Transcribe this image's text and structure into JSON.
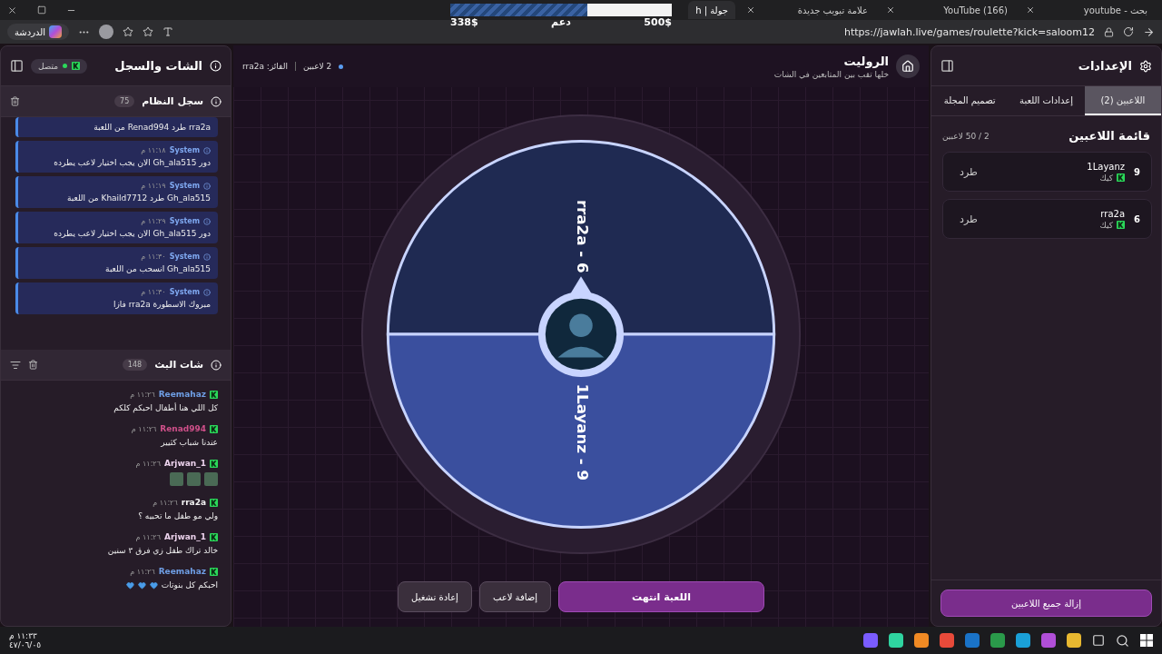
{
  "browser": {
    "tabs": [
      {
        "title": "بحث - youtube",
        "selected": false
      },
      {
        "title": "(166) YouTube",
        "selected": false
      },
      {
        "title": "علامة تبويب جديدة",
        "selected": false
      },
      {
        "title": "جولة | h",
        "selected": true
      }
    ],
    "url": "https://jawlah.live/games/roulette?kick=saloom12",
    "chat_button": "الدردشة"
  },
  "donation_overlay": {
    "level": 0.62,
    "raised": "338$",
    "label": "دعم",
    "goal": "500$"
  },
  "settings": {
    "title": "الإعدادات",
    "tabs": [
      {
        "label": "اللاعبين (2)",
        "selected": true
      },
      {
        "label": "إعدادات اللعبة",
        "selected": false
      },
      {
        "label": "تصميم المجلة",
        "selected": false
      }
    ],
    "list_title": "قائمة اللاعبين",
    "count": "2 / 50 لاعبين",
    "players": [
      {
        "number": "9",
        "name": "1Layanz",
        "platform": "كيك",
        "action": "طرد"
      },
      {
        "number": "6",
        "name": "rra2a",
        "platform": "كيك",
        "action": "طرد"
      }
    ],
    "remove_all": "إزالة جميع اللاعبين"
  },
  "game": {
    "title": "الروليت",
    "subtitle": "خلها تقب بين المتابعين في الشات",
    "players": "2 لاعبين",
    "winner": "الفائز: rra2a",
    "wheel": {
      "segments": [
        {
          "label": "rra2a - 6",
          "color": "#1f2a52"
        },
        {
          "label": "1Layanz - 9",
          "color": "#3a4f9e"
        }
      ]
    },
    "buttons": [
      {
        "label": "اللعبة انتهت",
        "kind": "primary"
      },
      {
        "label": "إضافة لاعب",
        "kind": "secondary"
      },
      {
        "label": "إعادة تشغيل",
        "kind": "secondary"
      }
    ]
  },
  "chat_panel": {
    "title": "الشات والسجل",
    "status": "متصل",
    "connected": true,
    "system_log": {
      "title": "سجل النظام",
      "count": "75",
      "entries": [
        {
          "text": "rra2a طرد Renad994 من اللعبة"
        },
        {
          "sender": "System",
          "time": "١١:١٨ م",
          "text": "دور Gh_ala515 الان يجب اختيار لاعب يطرده"
        },
        {
          "sender": "System",
          "time": "١١:١٩ م",
          "text": "Gh_ala515 طرد Khaild7712 من اللعبة"
        },
        {
          "sender": "System",
          "time": "١١:٢٩ م",
          "text": "دور Gh_ala515 الان يجب اختيار لاعب يطرده"
        },
        {
          "sender": "System",
          "time": "١١:٣٠ م",
          "text": "Gh_ala515 انسحب من اللعبة"
        },
        {
          "sender": "System",
          "time": "١١:٣٠ م",
          "text": "مبروك الاسطورة rra2a فازا"
        }
      ]
    },
    "stream_chat": {
      "title": "شات البث",
      "count": "148",
      "messages": [
        {
          "kind": "text",
          "user": "Reemahaz",
          "color": "#6f9fe6",
          "time": "١١:٢٦ م",
          "text": "كل اللي هنا أطفال احبكم كلكم"
        },
        {
          "kind": "text",
          "user": "Renad994",
          "color": "#d0508a",
          "time": "١١:٢٦ م",
          "text": "عندنا شباب كثيير"
        },
        {
          "kind": "emotes",
          "user": "Arjwan_1",
          "color": "#ecd2ec",
          "time": "١١:٢٦ م",
          "emotes": [
            {
              "kind": "image"
            },
            {
              "kind": "image"
            },
            {
              "kind": "image"
            }
          ]
        },
        {
          "kind": "text",
          "user": "rra2a",
          "color": "#f4f4f4",
          "time": "١١:٢٦ م",
          "text": "ولي مو طفل ما تحبيه ؟"
        },
        {
          "kind": "text",
          "user": "Arjwan_1",
          "color": "#ecd2ec",
          "time": "١١:٢٦ م",
          "text": "خالد تراك طفل زي فرق ٣ سنين"
        },
        {
          "kind": "text",
          "user": "Reemahaz",
          "color": "#6f9fe6",
          "time": "١١:٢٦ م",
          "text": "احبكم كل بنوتات",
          "reactions": [
            {
              "kind": "heart"
            },
            {
              "kind": "heart"
            },
            {
              "kind": "heart"
            }
          ]
        }
      ]
    }
  },
  "taskbar": {
    "time": "١١:٣٣ م",
    "date": "٤٧/٠٦/٠٥"
  }
}
